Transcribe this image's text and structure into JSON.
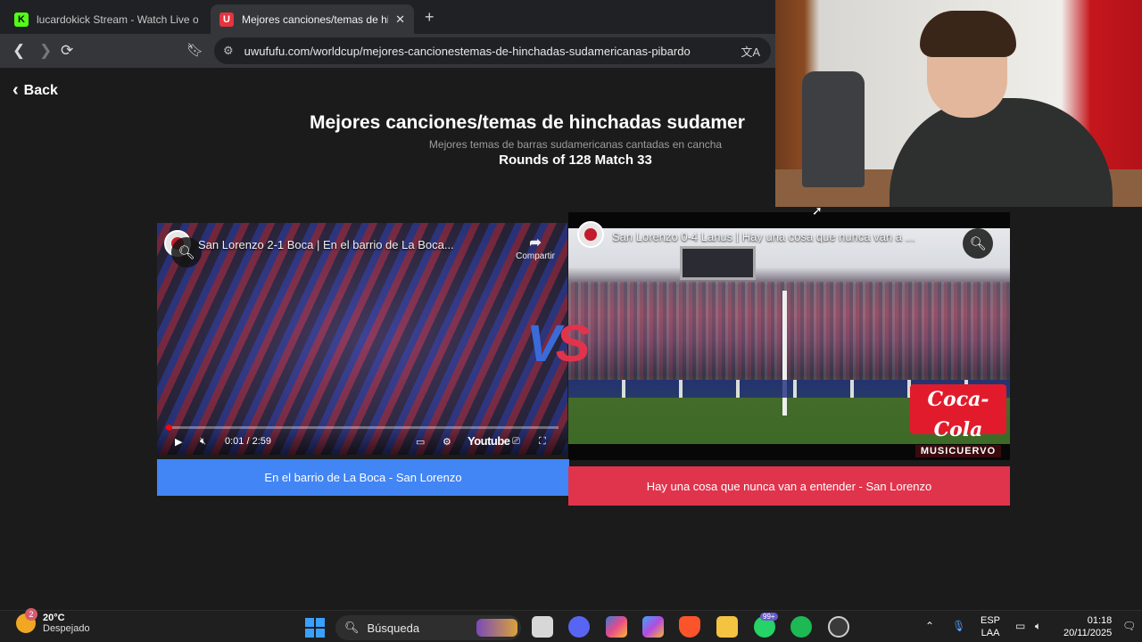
{
  "browser": {
    "tabs": [
      {
        "label": "lucardokick Stream - Watch Live on K",
        "favicon": "kick-logo-icon",
        "active": false
      },
      {
        "label": "Mejores canciones/temas de hin",
        "favicon": "uwufufu-logo-icon",
        "active": true
      }
    ],
    "new_tab_symbol": "+",
    "url": "uwufufu.com/worldcup/mejores-cancionestemas-de-hinchadas-sudamericanas-pibardo"
  },
  "page": {
    "back_label": "Back",
    "title": "Mejores canciones/temas de hinchadas sudamer",
    "subtitle": "Mejores temas de barras sudamericanas cantadas en cancha",
    "round_info": "Rounds of 128 Match 33"
  },
  "match": {
    "left": {
      "video_title": "San Lorenzo 2-1 Boca | En el barrio de La Boca...",
      "share_label": "Compartir",
      "time": "0:01 / 2:59",
      "youtube_label": "Youtube",
      "choice_label": "En el barrio de La Boca - San Lorenzo",
      "color": "#4285f4"
    },
    "right": {
      "video_title": "San Lorenzo 0-4 Lanus | Hay una cosa que nunca van a ...",
      "brand_text": "Coca-Cola",
      "channel_text": "MUSICUERVO",
      "choice_label": "Hay una cosa que nunca van a entender - San Lorenzo",
      "color": "#e0344c"
    },
    "vs_v": "V",
    "vs_s": "S"
  },
  "taskbar": {
    "weather_badge": "2",
    "temperature": "20°C",
    "condition": "Despejado",
    "search_placeholder": "Búsqueda",
    "whatsapp_badge": "99+",
    "lang_top": "ESP",
    "lang_bottom": "LAA",
    "time": "01:18",
    "date": "20/11/2025"
  }
}
